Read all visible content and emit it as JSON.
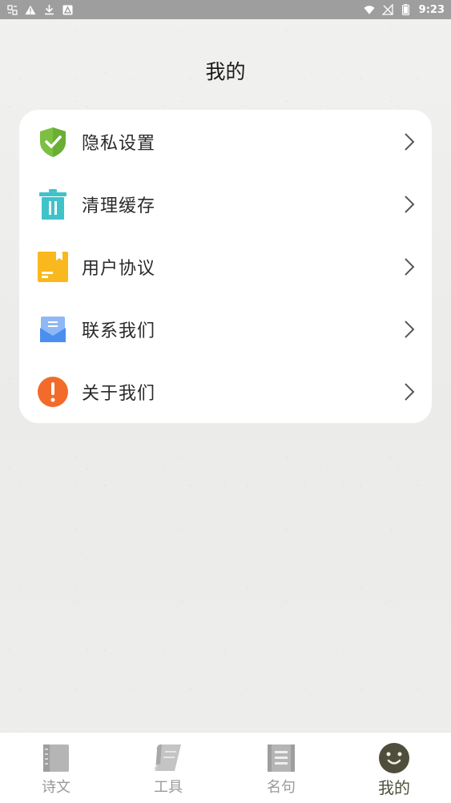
{
  "status_bar": {
    "time": "9:23",
    "left_icons": [
      "notification-icon",
      "warning-icon",
      "download-icon",
      "app-notice-icon"
    ],
    "right_icons": [
      "wifi-icon",
      "no-sim-icon",
      "battery-icon"
    ]
  },
  "header": {
    "title": "我的"
  },
  "menu": {
    "items": [
      {
        "label": "隐私设置",
        "icon": "shield-check-icon",
        "color": "#7bc043"
      },
      {
        "label": "清理缓存",
        "icon": "trash-icon",
        "color": "#3ec3c9"
      },
      {
        "label": "用户协议",
        "icon": "document-icon",
        "color": "#f9b81e"
      },
      {
        "label": "联系我们",
        "icon": "mail-icon",
        "color": "#4a8ff0"
      },
      {
        "label": "关于我们",
        "icon": "info-alert-icon",
        "color": "#f26b2a"
      }
    ]
  },
  "bottom_nav": {
    "items": [
      {
        "label": "诗文",
        "icon": "book-icon",
        "active": false
      },
      {
        "label": "工具",
        "icon": "scroll-icon",
        "active": false
      },
      {
        "label": "名句",
        "icon": "quote-card-icon",
        "active": false
      },
      {
        "label": "我的",
        "icon": "smiley-face-icon",
        "active": true
      }
    ],
    "active_color": "#4f4e3d",
    "inactive_color": "#9a9a9a"
  }
}
